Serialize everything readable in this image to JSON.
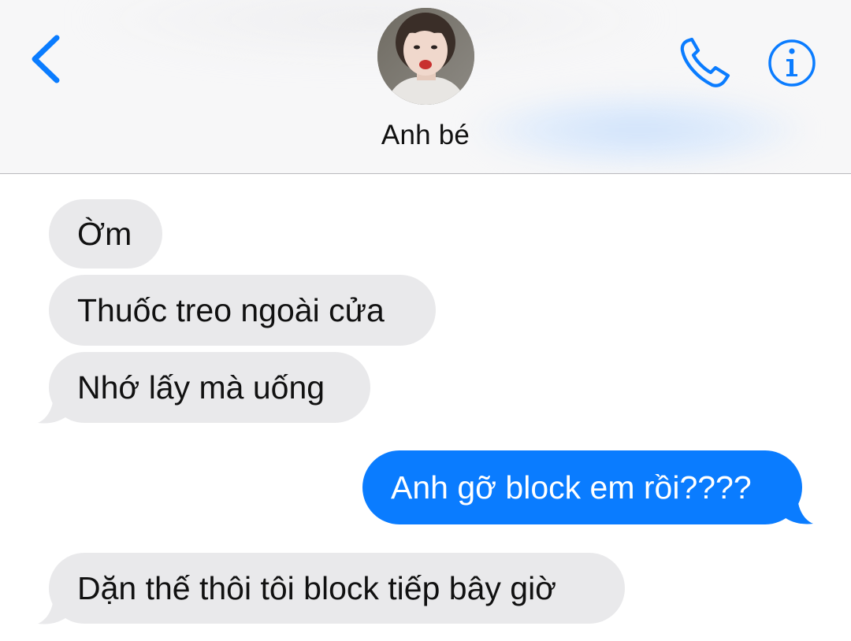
{
  "header": {
    "contact_name": "Anh bé",
    "icons": {
      "back": "chevron-left-icon",
      "call": "phone-icon",
      "info": "info-icon"
    }
  },
  "messages": [
    {
      "direction": "incoming",
      "text": "Ờm"
    },
    {
      "direction": "incoming",
      "text": "Thuốc treo ngoài cửa"
    },
    {
      "direction": "incoming",
      "text": "Nhớ lấy mà uống"
    },
    {
      "direction": "outgoing",
      "text": "Anh gỡ block em rồi????"
    },
    {
      "direction": "incoming",
      "text": "Dặn thế thôi tôi block tiếp bây giờ"
    }
  ],
  "colors": {
    "accent": "#0a7cff",
    "incoming_bubble": "#e9e9eb",
    "header_bg": "#f7f7f8"
  }
}
